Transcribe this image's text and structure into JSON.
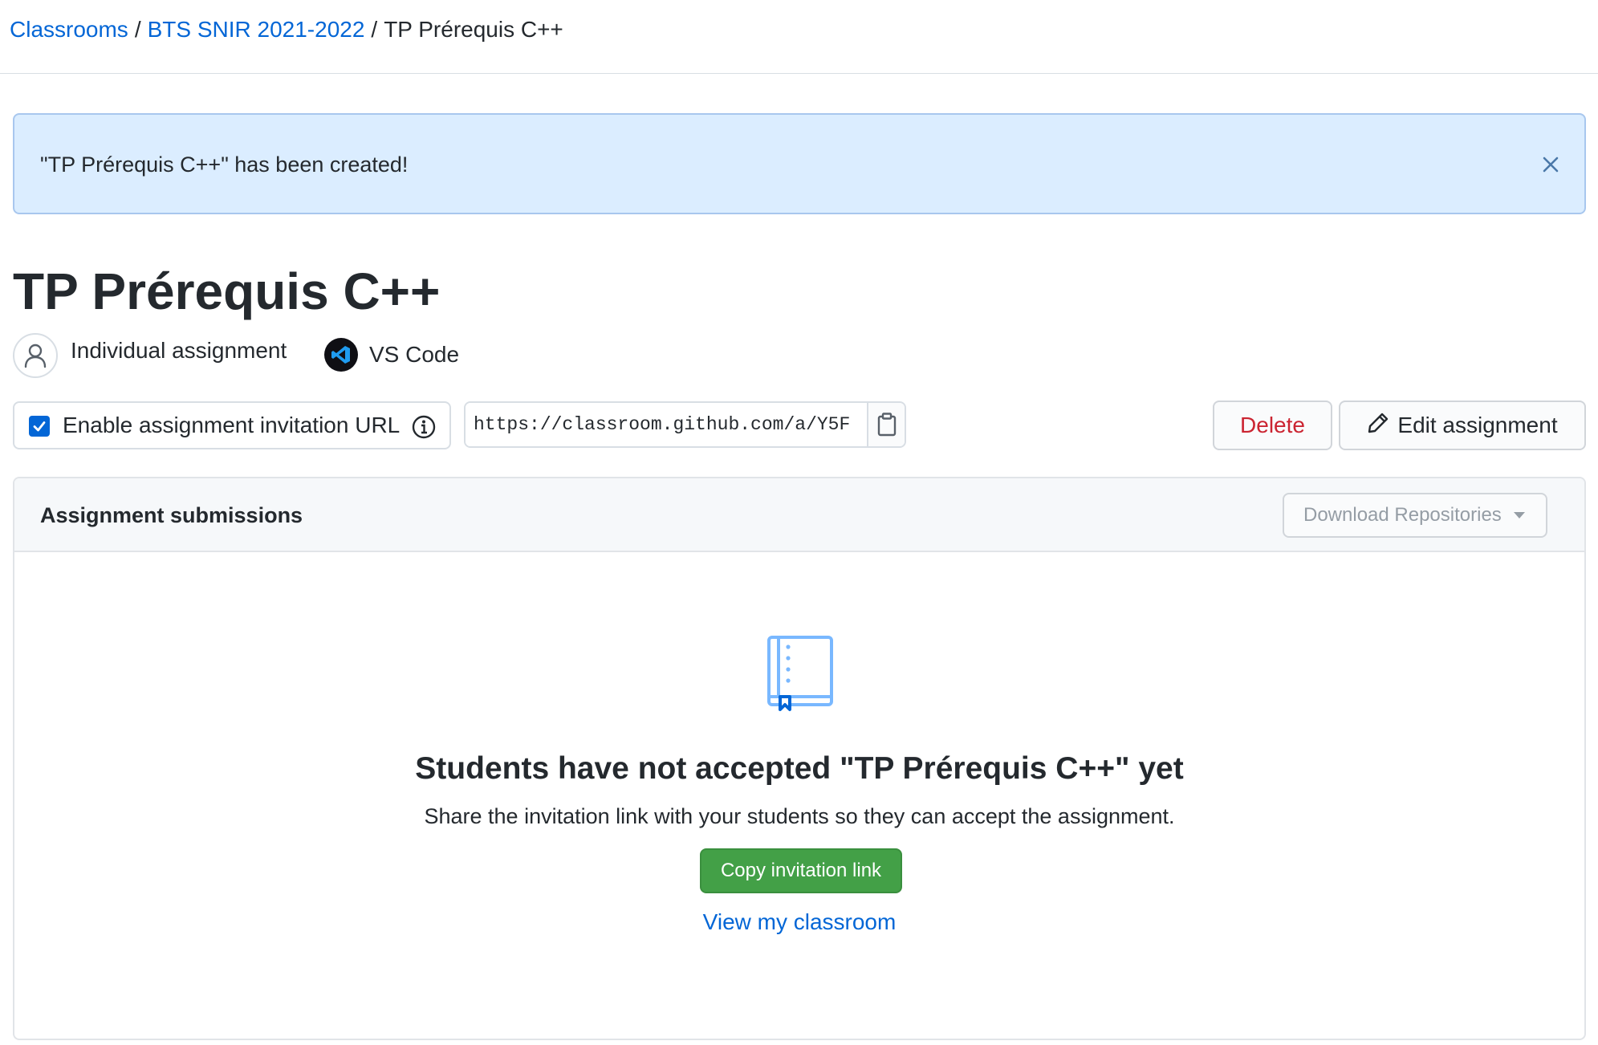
{
  "breadcrumb": {
    "items": [
      {
        "label": "Classrooms"
      },
      {
        "label": "BTS SNIR 2021-2022"
      }
    ],
    "separator": "/",
    "current": "TP Prérequis C++"
  },
  "flash": {
    "message": "\"TP Prérequis C++\" has been created!",
    "close_icon": "close-icon"
  },
  "assignment": {
    "title": "TP Prérequis C++",
    "type_label": "Individual assignment",
    "type_icon": "person-icon",
    "editor_label": "VS Code",
    "editor_icon": "vscode-icon"
  },
  "invitation": {
    "enable_label": "Enable assignment invitation URL",
    "enabled": true,
    "url_value": "https://classroom.github.com/a/Y5F",
    "info_icon": "info-icon",
    "copy_icon": "clipboard-icon"
  },
  "actions": {
    "delete_label": "Delete",
    "edit_label": "Edit assignment",
    "edit_icon": "pencil-icon"
  },
  "submissions": {
    "title": "Assignment submissions",
    "download_label": "Download Repositories",
    "empty_icon": "book-icon",
    "empty_title": "Students have not accepted \"TP Prérequis C++\" yet",
    "empty_text": "Share the invitation link with your students so they can accept the assignment.",
    "copy_button_label": "Copy invitation link",
    "view_link_label": "View my classroom"
  },
  "colors": {
    "link": "#0366d6",
    "flash_bg": "#dbedff",
    "danger": "#cb2431",
    "success": "#43a047",
    "checkbox": "#0366d6"
  }
}
